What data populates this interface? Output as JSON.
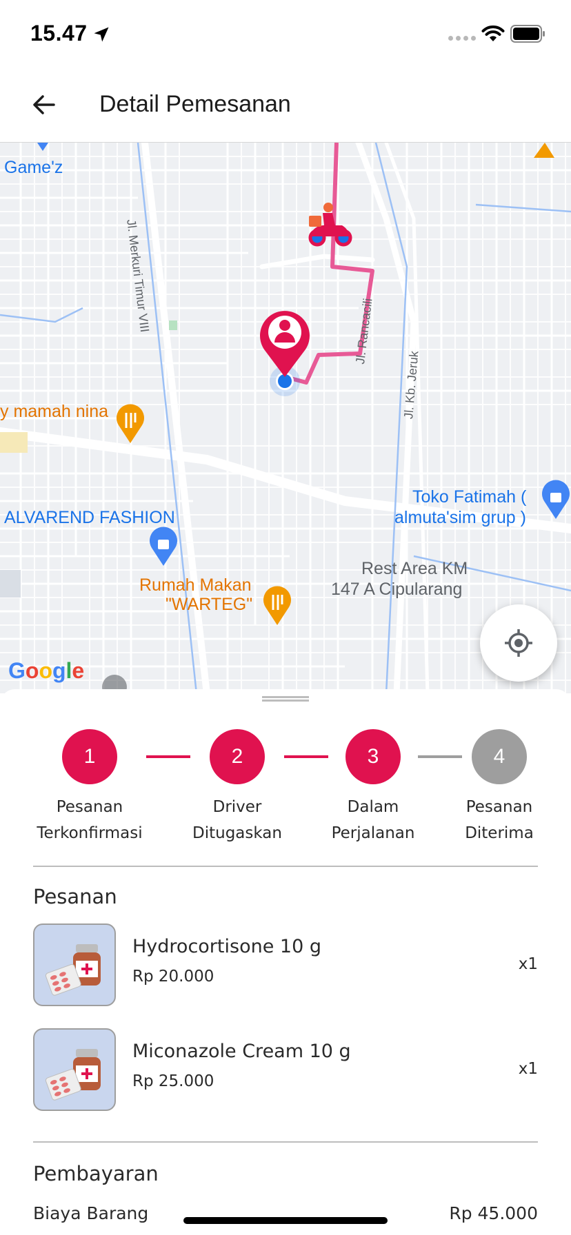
{
  "status_bar": {
    "time": "15.47"
  },
  "app_bar": {
    "title": "Detail Pemesanan"
  },
  "map": {
    "labels": {
      "gamez": "Game'z",
      "merkuri": "Jl. Merkuri Timur VIII",
      "rancacili": "Jl. Rancacili",
      "kbjeruk": "Jl. Kb. Jeruk",
      "mamah_nina": "y mamah nina",
      "toko_fatimah_1": "Toko Fatimah (",
      "toko_fatimah_2": "almuta'sim grup )",
      "alvarend": "ALVAREND FASHION",
      "rest_area_1": "Rest Area KM",
      "rest_area_2": "147 A Cipularang",
      "rumah_makan_1": "Rumah Makan",
      "rumah_makan_2": "\"WARTEG\""
    },
    "google": {
      "g1": "G",
      "o1": "o",
      "o2": "o",
      "g2": "g",
      "l": "l",
      "e": "e"
    },
    "route_color": "#e75a96",
    "pin_color": "#e0124f"
  },
  "stepper": {
    "active_color": "#e0124f",
    "inactive_color": "#9e9e9e",
    "steps": [
      {
        "number": "1",
        "line1": "Pesanan",
        "line2": "Terkonfirmasi",
        "state": "active"
      },
      {
        "number": "2",
        "line1": "Driver",
        "line2": "Ditugaskan",
        "state": "active"
      },
      {
        "number": "3",
        "line1": "Dalam",
        "line2": "Perjalanan",
        "state": "active"
      },
      {
        "number": "4",
        "line1": "Pesanan",
        "line2": "Diterima",
        "state": "inactive"
      }
    ]
  },
  "order": {
    "title": "Pesanan",
    "items": [
      {
        "name": "Hydrocortisone 10 g",
        "price": "Rp 20.000",
        "qty": "x1",
        "icon": "medicine-icon"
      },
      {
        "name": "Miconazole Cream 10 g",
        "price": "Rp 25.000",
        "qty": "x1",
        "icon": "medicine-icon"
      }
    ]
  },
  "payment": {
    "title": "Pembayaran",
    "rows": [
      {
        "label": "Biaya Barang",
        "value": "Rp 45.000"
      }
    ]
  }
}
